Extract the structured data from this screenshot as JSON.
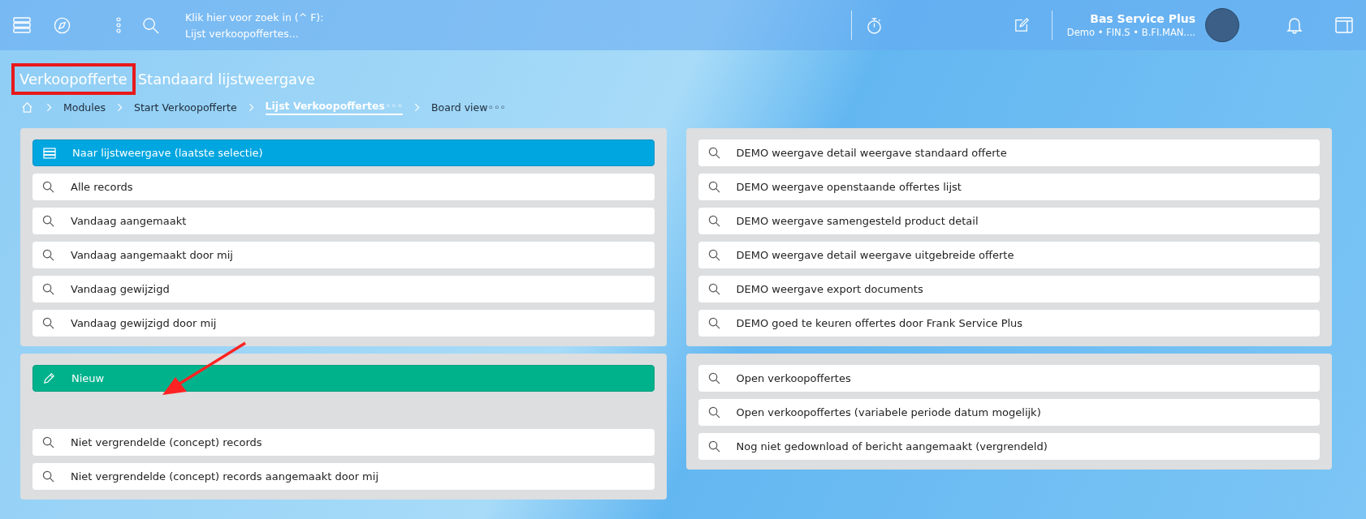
{
  "topbar": {
    "search_hint": "Klik hier voor zoek in (^ F):",
    "search_context": "Lijst verkoopoffertes...",
    "user": {
      "name": "Bas Service Plus",
      "details": "Demo • FIN.S • B.FI.MAN...."
    }
  },
  "page_title": {
    "prefix": "Verkoopofferte",
    "rest": "Standaard lijstweergave",
    "prefix_highlighted": true
  },
  "breadcrumbs": [
    {
      "label": "Modules",
      "selected": false
    },
    {
      "label": "Start Verkoopofferte",
      "selected": false
    },
    {
      "label": "Lijst Verkoopoffertes",
      "more": "◦◦◦",
      "selected": true
    },
    {
      "label": "Board view",
      "more": "◦◦◦",
      "selected": false
    }
  ],
  "annotation_arrow": true,
  "left_panel": {
    "groups": [
      {
        "items": [
          {
            "kind": "list",
            "label": "Naar lijstweergave (laatste selectie)"
          },
          {
            "kind": "search",
            "label": "Alle records"
          },
          {
            "kind": "search",
            "label": "Vandaag aangemaakt"
          },
          {
            "kind": "search",
            "label": "Vandaag aangemaakt door mij"
          },
          {
            "kind": "search",
            "label": "Vandaag gewijzigd"
          },
          {
            "kind": "search",
            "label": "Vandaag gewijzigd door mij"
          }
        ]
      },
      {
        "items": [
          {
            "kind": "new",
            "label": "Nieuw"
          }
        ],
        "after_gap": [
          {
            "kind": "search",
            "label": "Niet vergrendelde (concept) records"
          },
          {
            "kind": "search",
            "label": "Niet vergrendelde (concept) records aangemaakt door mij"
          }
        ]
      }
    ]
  },
  "right_panel": {
    "groups": [
      {
        "items": [
          {
            "kind": "search",
            "label": "DEMO weergave detail weergave standaard offerte"
          },
          {
            "kind": "search",
            "label": "DEMO weergave openstaande offertes lijst"
          },
          {
            "kind": "search",
            "label": "DEMO weergave samengesteld product detail"
          },
          {
            "kind": "search",
            "label": "DEMO weergave detail weergave uitgebreide offerte"
          },
          {
            "kind": "search",
            "label": "DEMO weergave export documents"
          },
          {
            "kind": "search",
            "label": "DEMO goed te keuren offertes door Frank Service Plus"
          }
        ]
      },
      {
        "items": [
          {
            "kind": "search",
            "label": "Open verkoopoffertes"
          },
          {
            "kind": "search",
            "label": "Open verkoopoffertes (variabele periode datum mogelijk)"
          },
          {
            "kind": "search",
            "label": "Nog niet gedownload of bericht aangemaakt (vergrendeld)"
          }
        ]
      }
    ]
  }
}
